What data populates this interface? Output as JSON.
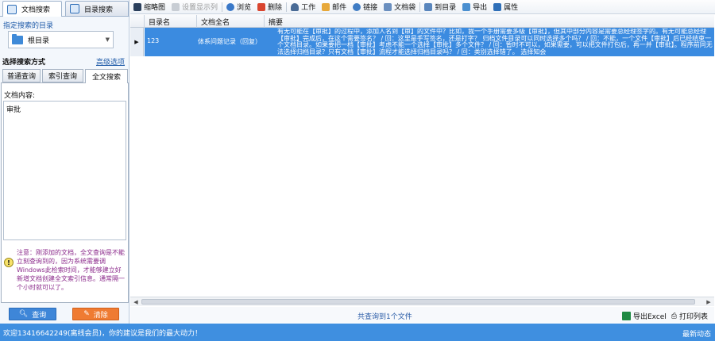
{
  "left_panel": {
    "tabs": [
      {
        "label": "文档搜索",
        "icon": "doc-search-icon",
        "active": true
      },
      {
        "label": "目录搜索",
        "icon": "dir-search-icon",
        "active": false
      }
    ],
    "dir_label": "指定搜索的目录",
    "dir_value": "根目录",
    "method_label": "选择搜索方式",
    "advanced_link": "高级选项",
    "search_tabs": [
      "普通查询",
      "索引查询",
      "全文搜索"
    ],
    "content_label": "文档内容:",
    "content_value": "审批",
    "note": "注意：刚添加的文档，全文查询是不能立刻查询到的，因为系统需要调Windows此检索时间，才能够建立好新增文档创建全文索引信息。通常隔一个小时就可以了。",
    "search_button": "查询",
    "clear_button": "清除"
  },
  "toolbar": {
    "items": [
      {
        "label": "缩略图",
        "icon": "thumbnail-icon",
        "enabled": true
      },
      {
        "label": "设置显示列",
        "icon": "columns-icon",
        "enabled": false
      },
      {
        "label": "浏览",
        "icon": "eye-icon",
        "enabled": true
      },
      {
        "label": "删除",
        "icon": "delete-icon",
        "enabled": true
      },
      {
        "label": "工作",
        "icon": "person-icon",
        "enabled": true
      },
      {
        "label": "邮件",
        "icon": "mail-icon",
        "enabled": true
      },
      {
        "label": "链接",
        "icon": "link-icon",
        "enabled": true
      },
      {
        "label": "文档袋",
        "icon": "bag-icon",
        "enabled": true
      },
      {
        "label": "到目录",
        "icon": "goto-dir-icon",
        "enabled": true
      },
      {
        "label": "导出",
        "icon": "export-icon",
        "enabled": true
      },
      {
        "label": "属性",
        "icon": "properties-icon",
        "enabled": true
      }
    ]
  },
  "grid": {
    "columns": [
      "目录名",
      "文档全名",
      "摘要"
    ],
    "rows": [
      {
        "dir": "123",
        "name": "体系问题记录（回复）",
        "summary": "有无可能在【审批】的过程中，添加人名到【审】的文件中？比如，我一个手册需要多级【审批】，但其中部分内容是需要总经理签字的。有无可能总经理【审批】完成后，在这个需要签名？ / 回：这里是手写签名，还是打字？ 归档文件目录可以同时选择多个吗？ / 回：不能，一个文件【审批】后已经结束一个文档目录。如果要把一档【审批】考虑不能一个选择【审批】多个文件？ / 回：暂时不可以，如果需要，可以把文件打包后，再一并【审批】。程序前同无法选择归档目录？只有文档【审批】流程才能选择归档目录吗？ / 回：类别选择错了。 选择知会"
      }
    ],
    "found_text": "共查询到1个文件",
    "export_text": "导出Excel",
    "print_text": "打印列表"
  },
  "status_bar": {
    "welcome": "欢迎13416642249(离线会员)，你的建议是我们的最大动力！",
    "news": "最新动态"
  }
}
